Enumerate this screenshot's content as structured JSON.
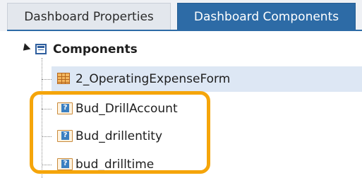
{
  "tabs": {
    "properties": "Dashboard Properties",
    "components": "Dashboard Components",
    "active": "Dashboard Components"
  },
  "tree": {
    "root": {
      "label": "Components",
      "expanded": true,
      "icon": "components-list-icon"
    },
    "children": [
      {
        "label": "2_OperatingExpenseForm",
        "icon": "form-grid-icon",
        "selected": true
      },
      {
        "label": "Bud_DrillAccount",
        "icon": "parameter-icon",
        "selected": false
      },
      {
        "label": "Bud_drillentity",
        "icon": "parameter-icon",
        "selected": false
      },
      {
        "label": "bud_drilltime",
        "icon": "parameter-icon",
        "selected": false
      }
    ]
  },
  "colors": {
    "accent": "#2d6ba6",
    "highlight": "#f5a50a",
    "selection": "#dde7f4"
  }
}
